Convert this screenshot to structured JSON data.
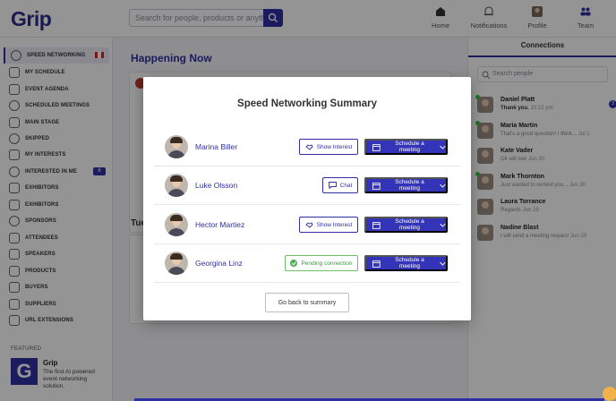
{
  "app": {
    "logo": "Grip",
    "search_placeholder": "Search for people, products or anything?"
  },
  "topnav": [
    {
      "label": "Home",
      "icon": "home-icon"
    },
    {
      "label": "Notifications",
      "icon": "bell-icon"
    },
    {
      "label": "Profile",
      "icon": "profile-avatar-icon"
    },
    {
      "label": "Team",
      "icon": "team-icon"
    }
  ],
  "sidebar": {
    "items": [
      {
        "label": "SPEED NETWORKING",
        "active": true,
        "flag": true
      },
      {
        "label": "MY SCHEDULE"
      },
      {
        "label": "EVENT AGENDA"
      },
      {
        "label": "SCHEDULED MEETINGS"
      },
      {
        "label": "MAIN STAGE"
      },
      {
        "label": "SKIPPED"
      },
      {
        "label": "MY INTERESTS"
      },
      {
        "label": "INTERESTED IN ME",
        "badge": "6"
      },
      {
        "label": "EXHIBITORS"
      },
      {
        "label": "EXHIBITORS"
      },
      {
        "label": "SPONSORS"
      },
      {
        "label": "ATTENDEES"
      },
      {
        "label": "SPEAKERS"
      },
      {
        "label": "PRODUCTS"
      },
      {
        "label": "BUYERS"
      },
      {
        "label": "SUPPLIERS"
      },
      {
        "label": "URL EXTENSIONS"
      }
    ],
    "featured": {
      "label": "FEATURED",
      "logo_letter": "G",
      "title": "Grip",
      "desc": "The first AI powered event networking solution."
    }
  },
  "main": {
    "heading": "Happening Now",
    "day_label": "Tue"
  },
  "connections": {
    "title": "Connections",
    "search_placeholder": "Search people",
    "items": [
      {
        "name": "Daniel Platt",
        "message": "Thank you.",
        "time": "10:22 pm",
        "online": true,
        "badge": "3",
        "bold": true
      },
      {
        "name": "Maria Martin",
        "message": "That's a good question! I think...",
        "time": "Jul 1",
        "online": true
      },
      {
        "name": "Kate Vader",
        "message": "Ok will see",
        "time": "Jun 30",
        "online": false
      },
      {
        "name": "Mark Thornton",
        "message": "Just wanted to remind you...",
        "time": "Jun 30",
        "online": true
      },
      {
        "name": "Laura Torrance",
        "message": "Regards",
        "time": "Jun 29",
        "online": false
      },
      {
        "name": "Nadine Blast",
        "message": "I will send a meeting request",
        "time": "Jun 29",
        "online": false
      }
    ]
  },
  "modal": {
    "title": "Speed Networking Summary",
    "rows": [
      {
        "name": "Marina Biller",
        "action": "Show Interest",
        "action_type": "interest",
        "schedule": "Schedule a meeting"
      },
      {
        "name": "Luke Olsson",
        "action": "Chat",
        "action_type": "chat",
        "schedule": "Schedule a meeting"
      },
      {
        "name": "Hector Martiez",
        "action": "Show Interest",
        "action_type": "interest",
        "schedule": "Schedule a meeting"
      },
      {
        "name": "Georgina Linz",
        "action": "Pending connection",
        "action_type": "pending",
        "schedule": "Schedule a meeting"
      }
    ],
    "back_label": "Go back to summary"
  },
  "colors": {
    "primary": "#2f2fa4",
    "pending": "#3d9a3d",
    "overlay": "rgba(0,0,0,0.42)"
  }
}
